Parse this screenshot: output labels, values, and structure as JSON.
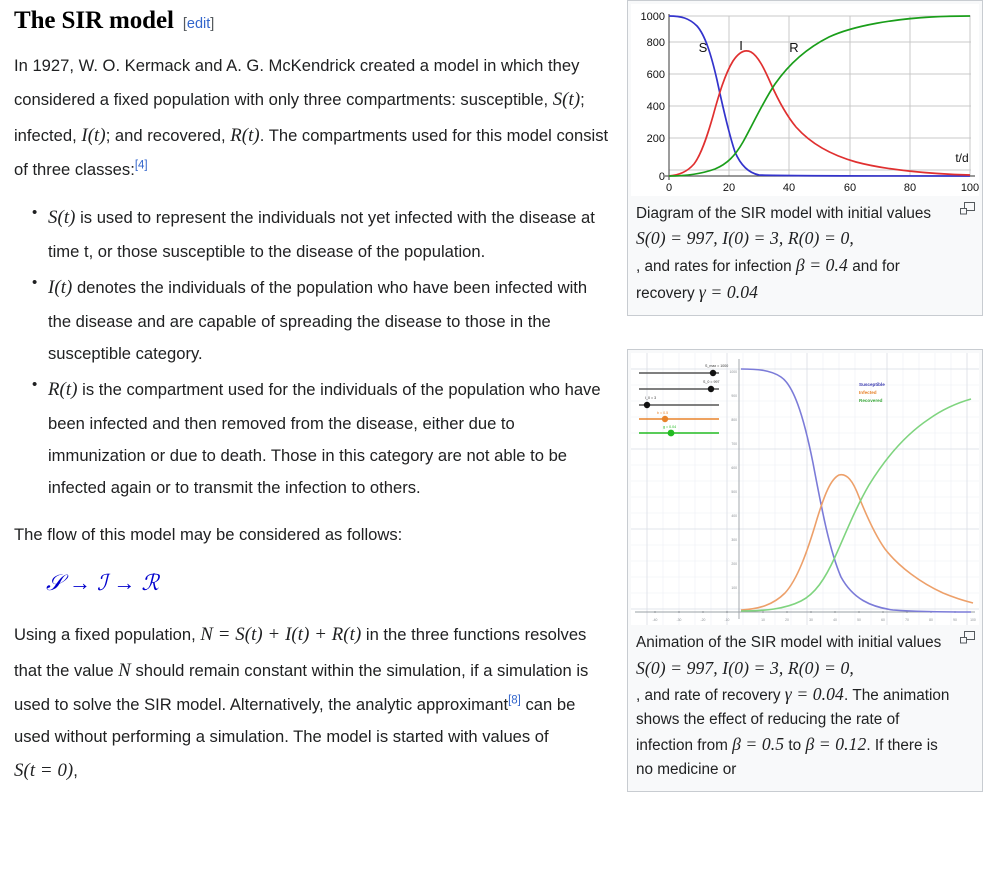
{
  "heading": {
    "title": "The SIR model",
    "edit_open": "[",
    "edit_label": "edit",
    "edit_close": "]"
  },
  "intro": {
    "p1_a": "In 1927, W. O. Kermack and A. G. McKendrick created a model in which they considered a fixed population with only three compartments: susceptible, ",
    "m_St": "S(t)",
    "p1_b": "; infected, ",
    "m_It": "I(t)",
    "p1_c": "; and recovered, ",
    "m_Rt": "R(t)",
    "p1_d": ". The compartments used for this model consist of three classes:",
    "ref1": "[4]"
  },
  "classes": [
    {
      "symbol": "S(t)",
      "text": " is used to represent the individuals not yet infected with the disease at time t, or those susceptible to the disease of the population."
    },
    {
      "symbol": "I(t)",
      "text": " denotes the individuals of the population who have been infected with the disease and are capable of spreading the disease to those in the susceptible category."
    },
    {
      "symbol": "R(t)",
      "text": " is the compartment used for the individuals of the population who have been infected and then removed from the disease, either due to immunization or due to death. Those in this category are not able to be infected again or to transmit the infection to others."
    }
  ],
  "flow_section": {
    "lead": "The flow of this model may be considered as follows:",
    "formula_s": "𝒮",
    "formula_arrow1": "→",
    "formula_i": "ℐ",
    "formula_arrow2": "→",
    "formula_r": "ℛ"
  },
  "closing": {
    "a": "Using a fixed population, ",
    "m_N": "N = S(t) + I(t) + R(t)",
    "b": " in the three functions resolves that the value ",
    "m_N2": "N",
    "c": " should remain constant within the simulation, if a simulation is used to solve the SIR model. Alternatively, the analytic approximant",
    "ref2": "[8]",
    "d": " can be used without performing a simulation. The model is started with values of ",
    "m_St0": "S(t = 0)",
    "e": ","
  },
  "thumb1": {
    "caption_a": "Diagram of the SIR model with initial values",
    "caption_math": "S(0) = 997, I(0) = 3, R(0) = 0",
    "caption_b": ", and rates for infection ",
    "caption_beta": "β = 0.4",
    "caption_c": " and for recovery ",
    "caption_gamma": "γ = 0.04",
    "magnify_icon": "enlarge-icon"
  },
  "thumb2": {
    "caption_a": "Animation of the SIR model with initial values",
    "caption_math": "S(0) = 997, I(0) = 3, R(0) = 0",
    "caption_b": ", and rate of recovery ",
    "caption_gamma": "γ = 0.04",
    "caption_c": ". The animation shows the effect of reducing the rate of infection from ",
    "caption_beta1": "β = 0.5",
    "caption_d": " to ",
    "caption_beta2": "β = 0.12",
    "caption_e": ". If there is no medicine or",
    "magnify_icon": "enlarge-icon"
  },
  "colors": {
    "link": "#3366cc",
    "susceptible": "#3333cc",
    "infected": "#e03030",
    "recovered": "#1a9e1a",
    "anim_susceptible": "#7b7bd8",
    "anim_infected": "#eda06a",
    "anim_recovered": "#7fd47f",
    "grid": "#c9c9c9",
    "thumb_border": "#c8ccd1",
    "thumb_bg": "#f8f9fa"
  },
  "chart_data": [
    {
      "type": "line",
      "title": "Diagram of the SIR model",
      "xlabel": "t/d",
      "ylabel": "",
      "xlim": [
        0,
        100
      ],
      "ylim": [
        0,
        1000
      ],
      "xticks": [
        0,
        20,
        40,
        60,
        80,
        100
      ],
      "yticks": [
        0,
        200,
        400,
        600,
        800,
        1000
      ],
      "grid": true,
      "legend": "inline-labels",
      "annotations": [
        {
          "label": "S",
          "x": 13,
          "y": 790
        },
        {
          "label": "I",
          "x": 24,
          "y": 800
        },
        {
          "label": "R",
          "x": 41,
          "y": 790
        }
      ],
      "x": [
        0,
        5,
        10,
        12,
        14,
        16,
        18,
        20,
        22,
        24,
        26,
        28,
        30,
        32,
        35,
        40,
        45,
        50,
        55,
        60,
        65,
        70,
        75,
        80,
        85,
        90,
        95,
        100
      ],
      "series": [
        {
          "name": "Susceptible",
          "color": "#3333cc",
          "values": [
            997,
            990,
            960,
            935,
            895,
            835,
            740,
            610,
            450,
            295,
            175,
            100,
            55,
            30,
            14,
            5,
            3,
            2,
            1,
            1,
            1,
            1,
            0,
            0,
            0,
            0,
            0,
            0
          ]
        },
        {
          "name": "Infected",
          "color": "#e03030",
          "values": [
            3,
            8,
            30,
            52,
            88,
            145,
            232,
            350,
            480,
            600,
            690,
            690,
            650,
            600,
            520,
            405,
            330,
            272,
            228,
            195,
            167,
            143,
            123,
            106,
            90,
            76,
            63,
            52
          ]
        },
        {
          "name": "Recovered",
          "color": "#1a9e1a",
          "values": [
            0,
            2,
            10,
            18,
            30,
            48,
            76,
            120,
            180,
            255,
            350,
            440,
            520,
            590,
            680,
            790,
            860,
            905,
            935,
            955,
            968,
            977,
            983,
            987,
            990,
            993,
            995,
            960
          ]
        }
      ]
    },
    {
      "type": "line",
      "title": "Animation of the SIR model",
      "xlabel": "",
      "ylabel": "",
      "xlim": [
        -30,
        110
      ],
      "ylim": [
        0,
        1050
      ],
      "grid": true,
      "legend": "top-right",
      "legend_entries": [
        "Susceptible",
        "Infected",
        "Recovered"
      ],
      "sliders": [
        {
          "label": "S_max = 1000",
          "color": "#333333",
          "pos": 0.93
        },
        {
          "label": "S_0 = 997",
          "color": "#333333",
          "pos": 0.9
        },
        {
          "label": "I_0 = 3",
          "color": "#333333",
          "pos": 0.1
        },
        {
          "label": "b = 0.5",
          "color": "#e8832b",
          "pos": 0.3
        },
        {
          "label": "g = 0.04",
          "color": "#22bb22",
          "pos": 0.36
        }
      ],
      "x": [
        0,
        5,
        10,
        15,
        20,
        25,
        30,
        35,
        40,
        45,
        50,
        55,
        60,
        65,
        70,
        75,
        80,
        85,
        90,
        95,
        100
      ],
      "series": [
        {
          "name": "Susceptible",
          "color": "#7b7bd8",
          "values": [
            997,
            994,
            988,
            975,
            948,
            890,
            780,
            610,
            420,
            262,
            158,
            95,
            60,
            40,
            28,
            20,
            15,
            12,
            10,
            8,
            7
          ]
        },
        {
          "name": "Infected",
          "color": "#eda06a",
          "values": [
            3,
            9,
            22,
            50,
            105,
            200,
            330,
            460,
            528,
            515,
            455,
            380,
            310,
            250,
            200,
            160,
            128,
            102,
            82,
            66,
            54
          ]
        },
        {
          "name": "Recovered",
          "color": "#7fd47f",
          "values": [
            0,
            1,
            4,
            12,
            28,
            60,
            120,
            215,
            345,
            480,
            600,
            695,
            770,
            825,
            865,
            895,
            918,
            935,
            948,
            958,
            965
          ]
        }
      ]
    }
  ]
}
